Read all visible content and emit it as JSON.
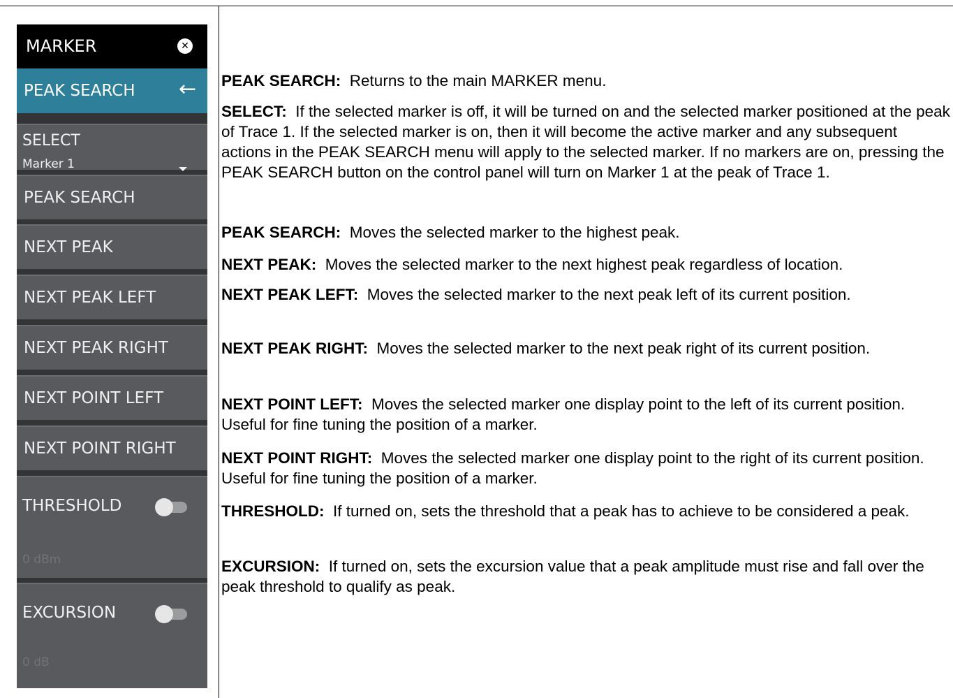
{
  "panel": {
    "title": "MARKER",
    "close_icon": "close-circle-icon",
    "back_nav": {
      "label": "PEAK SEARCH",
      "icon": "arrow-left-icon"
    },
    "select": {
      "label": "SELECT",
      "value": "Marker 1"
    },
    "buttons": [
      "PEAK SEARCH",
      "NEXT PEAK",
      "NEXT PEAK LEFT",
      "NEXT PEAK RIGHT",
      "NEXT POINT LEFT",
      "NEXT POINT RIGHT"
    ],
    "threshold": {
      "label": "THRESHOLD",
      "enabled": false,
      "value": "0 dBm"
    },
    "excursion": {
      "label": "EXCURSION",
      "enabled": false,
      "value": "0 dB"
    }
  },
  "colors": {
    "header_bg": "#000000",
    "accent": "#2d7f9a",
    "button_bg": "#585a5d",
    "panel_bg": "#323436"
  },
  "descriptions": [
    {
      "term": "PEAK SEARCH:",
      "text": "Returns to the main MARKER menu."
    },
    {
      "term": "SELECT:",
      "text": "If the selected marker is off, it will be turned on and the selected marker positioned at the peak of Trace 1. If the selected marker is on, then it will become the active marker and any subsequent actions in the PEAK SEARCH menu will apply to the selected marker. If no markers are on, pressing the PEAK SEARCH button on the control panel will turn on Marker 1 at the peak of Trace 1."
    },
    {
      "term": "PEAK SEARCH:",
      "text": "Moves the selected marker to the highest peak."
    },
    {
      "term": "NEXT PEAK:",
      "text": "Moves the selected marker to the next highest peak regardless of location."
    },
    {
      "term": "NEXT PEAK LEFT:",
      "text": "Moves the selected marker to the next peak left of its current position."
    },
    {
      "term": "NEXT PEAK RIGHT:",
      "text": "Moves the selected marker to the next peak right of its current position."
    },
    {
      "term": "NEXT POINT LEFT:",
      "text": "Moves the selected marker one display point to the left of its current position. Useful for fine tuning the position of a marker."
    },
    {
      "term": "NEXT POINT RIGHT:",
      "text": "Moves the selected marker one display point to the right of its current position. Useful for fine tuning the position of a marker."
    },
    {
      "term": "THRESHOLD:",
      "text": "If turned on, sets the threshold that a peak has to achieve to be considered a peak."
    },
    {
      "term": "EXCURSION:",
      "text": "If turned on, sets the excursion value that a peak amplitude must rise and fall over the peak threshold to qualify as peak."
    }
  ]
}
